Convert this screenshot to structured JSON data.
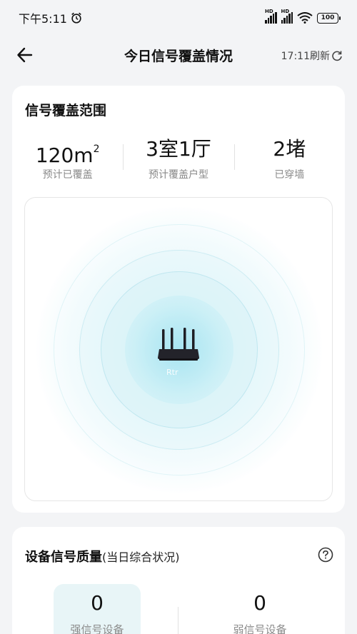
{
  "status": {
    "time": "下午5:11",
    "hd1": "HD",
    "hd2": "HD",
    "battery": "100"
  },
  "header": {
    "title": "今日信号覆盖情况",
    "refresh_time": "17:11刷新"
  },
  "coverage": {
    "title": "信号覆盖范围",
    "stats": [
      {
        "value": "120m",
        "sup": "2",
        "label": "预计已覆盖"
      },
      {
        "value": "3室1厅",
        "sup": "",
        "label": "预计覆盖户型"
      },
      {
        "value": "2堵",
        "sup": "",
        "label": "已穿墙"
      }
    ],
    "router_label": "Rtr"
  },
  "quality": {
    "title": "设备信号质量",
    "subtitle": "(当日综合状况)",
    "strong": {
      "count": "0",
      "label": "强信号设备"
    },
    "weak": {
      "count": "0",
      "label": "弱信号设备"
    }
  },
  "colors": {
    "accent_light": "#e8f5f7",
    "ring_color": "#bfe9f2"
  }
}
